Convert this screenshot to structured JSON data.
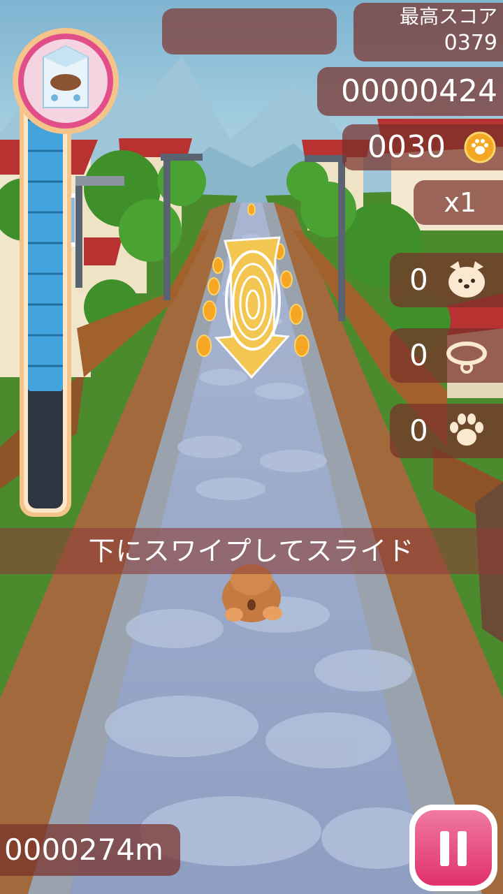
{
  "hud": {
    "best_score_label": "最高スコア",
    "best_score_value": "0379",
    "score": "00000424",
    "coins": "0030",
    "multiplier": "x1",
    "puppies": "0",
    "collars": "0",
    "paws": "0",
    "distance": "0000274m"
  },
  "meter": {
    "fill_fraction": 0.72
  },
  "tutorial": {
    "hint": "下にスワイプしてスライド"
  },
  "colors": {
    "panel": "#7a302a",
    "meter_fill": "#43a3dc",
    "meter_frame": "#f5c48a",
    "coin": "#f5a623",
    "pause_button": "#e0306e"
  },
  "icons": {
    "meter": "milk-carton-icon",
    "coin": "paw-coin-icon",
    "puppy": "puppy-face-icon",
    "collar": "collar-icon",
    "paw": "paw-print-icon",
    "pause": "pause-icon",
    "gesture": "swipe-down-icon"
  }
}
